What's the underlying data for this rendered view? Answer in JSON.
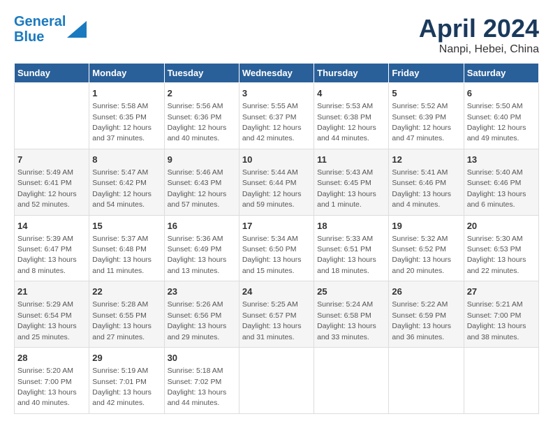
{
  "header": {
    "logo_line1": "General",
    "logo_line2": "Blue",
    "title": "April 2024",
    "subtitle": "Nanpi, Hebei, China"
  },
  "calendar": {
    "headers": [
      "Sunday",
      "Monday",
      "Tuesday",
      "Wednesday",
      "Thursday",
      "Friday",
      "Saturday"
    ],
    "weeks": [
      [
        {
          "day": "",
          "info": ""
        },
        {
          "day": "1",
          "info": "Sunrise: 5:58 AM\nSunset: 6:35 PM\nDaylight: 12 hours\nand 37 minutes."
        },
        {
          "day": "2",
          "info": "Sunrise: 5:56 AM\nSunset: 6:36 PM\nDaylight: 12 hours\nand 40 minutes."
        },
        {
          "day": "3",
          "info": "Sunrise: 5:55 AM\nSunset: 6:37 PM\nDaylight: 12 hours\nand 42 minutes."
        },
        {
          "day": "4",
          "info": "Sunrise: 5:53 AM\nSunset: 6:38 PM\nDaylight: 12 hours\nand 44 minutes."
        },
        {
          "day": "5",
          "info": "Sunrise: 5:52 AM\nSunset: 6:39 PM\nDaylight: 12 hours\nand 47 minutes."
        },
        {
          "day": "6",
          "info": "Sunrise: 5:50 AM\nSunset: 6:40 PM\nDaylight: 12 hours\nand 49 minutes."
        }
      ],
      [
        {
          "day": "7",
          "info": "Sunrise: 5:49 AM\nSunset: 6:41 PM\nDaylight: 12 hours\nand 52 minutes."
        },
        {
          "day": "8",
          "info": "Sunrise: 5:47 AM\nSunset: 6:42 PM\nDaylight: 12 hours\nand 54 minutes."
        },
        {
          "day": "9",
          "info": "Sunrise: 5:46 AM\nSunset: 6:43 PM\nDaylight: 12 hours\nand 57 minutes."
        },
        {
          "day": "10",
          "info": "Sunrise: 5:44 AM\nSunset: 6:44 PM\nDaylight: 12 hours\nand 59 minutes."
        },
        {
          "day": "11",
          "info": "Sunrise: 5:43 AM\nSunset: 6:45 PM\nDaylight: 13 hours\nand 1 minute."
        },
        {
          "day": "12",
          "info": "Sunrise: 5:41 AM\nSunset: 6:46 PM\nDaylight: 13 hours\nand 4 minutes."
        },
        {
          "day": "13",
          "info": "Sunrise: 5:40 AM\nSunset: 6:46 PM\nDaylight: 13 hours\nand 6 minutes."
        }
      ],
      [
        {
          "day": "14",
          "info": "Sunrise: 5:39 AM\nSunset: 6:47 PM\nDaylight: 13 hours\nand 8 minutes."
        },
        {
          "day": "15",
          "info": "Sunrise: 5:37 AM\nSunset: 6:48 PM\nDaylight: 13 hours\nand 11 minutes."
        },
        {
          "day": "16",
          "info": "Sunrise: 5:36 AM\nSunset: 6:49 PM\nDaylight: 13 hours\nand 13 minutes."
        },
        {
          "day": "17",
          "info": "Sunrise: 5:34 AM\nSunset: 6:50 PM\nDaylight: 13 hours\nand 15 minutes."
        },
        {
          "day": "18",
          "info": "Sunrise: 5:33 AM\nSunset: 6:51 PM\nDaylight: 13 hours\nand 18 minutes."
        },
        {
          "day": "19",
          "info": "Sunrise: 5:32 AM\nSunset: 6:52 PM\nDaylight: 13 hours\nand 20 minutes."
        },
        {
          "day": "20",
          "info": "Sunrise: 5:30 AM\nSunset: 6:53 PM\nDaylight: 13 hours\nand 22 minutes."
        }
      ],
      [
        {
          "day": "21",
          "info": "Sunrise: 5:29 AM\nSunset: 6:54 PM\nDaylight: 13 hours\nand 25 minutes."
        },
        {
          "day": "22",
          "info": "Sunrise: 5:28 AM\nSunset: 6:55 PM\nDaylight: 13 hours\nand 27 minutes."
        },
        {
          "day": "23",
          "info": "Sunrise: 5:26 AM\nSunset: 6:56 PM\nDaylight: 13 hours\nand 29 minutes."
        },
        {
          "day": "24",
          "info": "Sunrise: 5:25 AM\nSunset: 6:57 PM\nDaylight: 13 hours\nand 31 minutes."
        },
        {
          "day": "25",
          "info": "Sunrise: 5:24 AM\nSunset: 6:58 PM\nDaylight: 13 hours\nand 33 minutes."
        },
        {
          "day": "26",
          "info": "Sunrise: 5:22 AM\nSunset: 6:59 PM\nDaylight: 13 hours\nand 36 minutes."
        },
        {
          "day": "27",
          "info": "Sunrise: 5:21 AM\nSunset: 7:00 PM\nDaylight: 13 hours\nand 38 minutes."
        }
      ],
      [
        {
          "day": "28",
          "info": "Sunrise: 5:20 AM\nSunset: 7:00 PM\nDaylight: 13 hours\nand 40 minutes."
        },
        {
          "day": "29",
          "info": "Sunrise: 5:19 AM\nSunset: 7:01 PM\nDaylight: 13 hours\nand 42 minutes."
        },
        {
          "day": "30",
          "info": "Sunrise: 5:18 AM\nSunset: 7:02 PM\nDaylight: 13 hours\nand 44 minutes."
        },
        {
          "day": "",
          "info": ""
        },
        {
          "day": "",
          "info": ""
        },
        {
          "day": "",
          "info": ""
        },
        {
          "day": "",
          "info": ""
        }
      ]
    ]
  }
}
